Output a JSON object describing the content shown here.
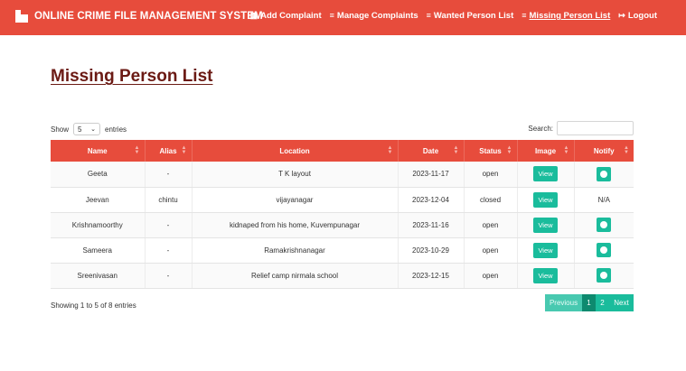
{
  "app": {
    "title": "ONLINE CRIME FILE MANAGEMENT SYSTEM"
  },
  "nav": {
    "items": [
      {
        "label": "Add Complaint",
        "icon": "file-icon"
      },
      {
        "label": "Manage Complaints",
        "icon": "list-icon"
      },
      {
        "label": "Wanted Person List",
        "icon": "list-icon"
      },
      {
        "label": "Missing Person List",
        "icon": "list-icon",
        "active": true
      },
      {
        "label": "Logout",
        "icon": "logout-icon"
      }
    ]
  },
  "page": {
    "title": "Missing Person List"
  },
  "controls": {
    "show_label": "Show",
    "entries_value": "5",
    "entries_label": "entries",
    "search_label": "Search:",
    "search_value": ""
  },
  "table": {
    "columns": [
      "Name",
      "Alias",
      "Location",
      "Date",
      "Status",
      "Image",
      "Notify"
    ],
    "rows": [
      {
        "name": "Geeta",
        "alias": "-",
        "location": "T K layout",
        "date": "2023-11-17",
        "status": "open",
        "image": "View",
        "notify": ""
      },
      {
        "name": "Jeevan",
        "alias": "chintu",
        "location": "vijayanagar",
        "date": "2023-12-04",
        "status": "closed",
        "image": "View",
        "notify": "N/A"
      },
      {
        "name": "Krishnamoorthy",
        "alias": "-",
        "location": "kidnaped from his home, Kuvempunagar",
        "date": "2023-11-16",
        "status": "open",
        "image": "View",
        "notify": ""
      },
      {
        "name": "Sameera",
        "alias": "-",
        "location": "Ramakrishnanagar",
        "date": "2023-10-29",
        "status": "open",
        "image": "View",
        "notify": ""
      },
      {
        "name": "Sreenivasan",
        "alias": "-",
        "location": "Relief camp nirmala school",
        "date": "2023-12-15",
        "status": "open",
        "image": "View",
        "notify": ""
      }
    ]
  },
  "footer": {
    "info": "Showing 1 to 5 of 8 entries",
    "pagination": {
      "previous": "Previous",
      "pages": [
        "1",
        "2"
      ],
      "current": "1",
      "next": "Next"
    }
  },
  "colors": {
    "primary": "#e74c3c",
    "accent": "#1abc9c",
    "title": "#6b1a14"
  }
}
